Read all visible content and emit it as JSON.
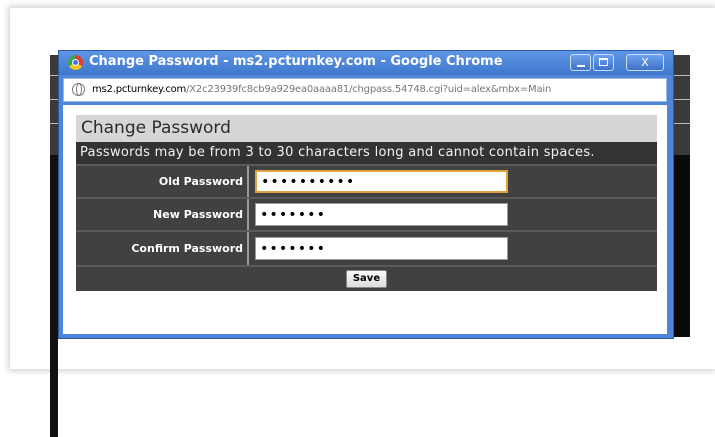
{
  "window": {
    "title": "Change Password - ms2.pcturnkey.com - Google Chrome",
    "close_label": "X"
  },
  "address_bar": {
    "host": "ms2.pcturnkey.com",
    "path": "/X2c23939fc8cb9a929ea0aaaa81/chgpass.54748.cgi?uid=alex&mbx=Main"
  },
  "page": {
    "title": "Change Password",
    "note": "Passwords may be from 3 to 30 characters long and cannot contain spaces.",
    "fields": [
      {
        "label": "Old Password",
        "value": "••••••••••"
      },
      {
        "label": "New Password",
        "value": "•••••••"
      },
      {
        "label": "Confirm Password",
        "value": "•••••••"
      }
    ],
    "save_label": "Save"
  },
  "colors": {
    "title_bar": "#4f86d8",
    "form_bg": "#414141",
    "focus_border": "#e0a23c"
  }
}
